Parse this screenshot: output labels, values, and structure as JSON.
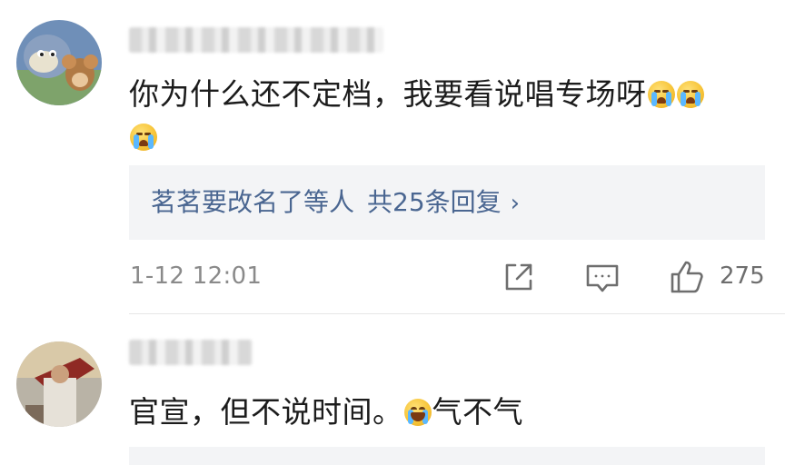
{
  "comments": [
    {
      "avatar_icon": "tom-and-jerry-avatar",
      "content_text": "你为什么还不定档，我要看说唱专场呀",
      "emojis": [
        "crying-face",
        "crying-face",
        "crying-face"
      ],
      "reply_preview": {
        "author": "茗茗要改名了等人",
        "count_label": "共25条回复",
        "chevron": "›"
      },
      "timestamp": "1-12 12:01",
      "actions": {
        "share_icon": "share-icon",
        "comment_icon": "comment-icon",
        "like_icon": "thumbs-up-icon"
      },
      "like_count": "275"
    },
    {
      "avatar_icon": "photo-avatar",
      "content_text": "官宣，但不说时间。",
      "content_after": "气不气",
      "emojis": [
        "laughing-tears-face"
      ]
    }
  ],
  "colors": {
    "link_blue": "#4a6691",
    "reply_bg": "#f3f4f6",
    "meta_gray": "#8a8a8a"
  }
}
